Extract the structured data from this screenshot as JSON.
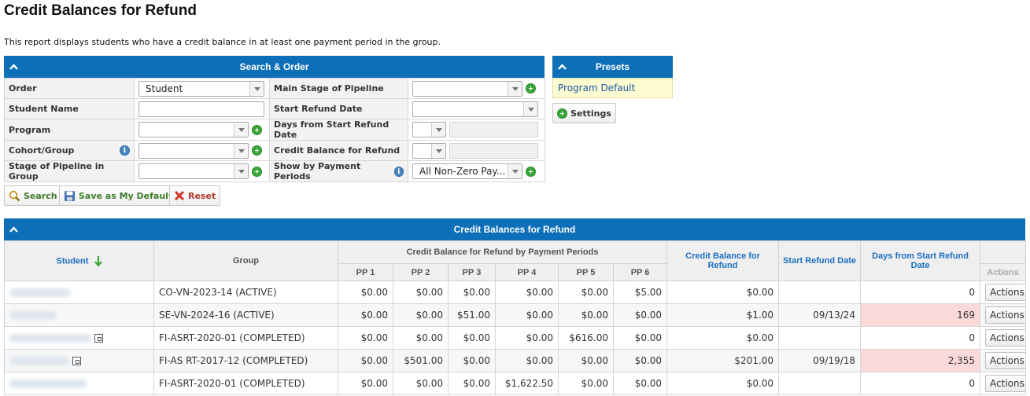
{
  "page": {
    "title": "Credit Balances for Refund",
    "intro": "This report displays students who have a credit balance in at least one payment period in the group."
  },
  "search": {
    "header": "Search & Order",
    "fields": {
      "order": {
        "label": "Order",
        "value": "Student"
      },
      "student_name": {
        "label": "Student Name",
        "value": ""
      },
      "program": {
        "label": "Program",
        "value": ""
      },
      "cohort_group": {
        "label": "Cohort/Group",
        "value": ""
      },
      "stage_in_group": {
        "label": "Stage of Pipeline in Group",
        "value": ""
      },
      "main_stage": {
        "label": "Main Stage of Pipeline",
        "value": ""
      },
      "start_refund_date": {
        "label": "Start Refund Date",
        "value": ""
      },
      "days_from_start": {
        "label": "Days from Start Refund Date",
        "value": ""
      },
      "credit_balance": {
        "label": "Credit Balance for Refund",
        "value": ""
      },
      "show_by_pp": {
        "label": "Show by Payment Periods",
        "value": "All Non-Zero Pay..."
      }
    },
    "buttons": {
      "search": "Search",
      "save_default": "Save as My Default",
      "reset": "Reset"
    }
  },
  "presets": {
    "header": "Presets",
    "items": [
      "Program Default"
    ],
    "settings_label": "Settings"
  },
  "results": {
    "header": "Credit Balances for Refund",
    "columns": {
      "student": "Student",
      "group": "Group",
      "pp_group": "Credit Balance for Refund by Payment Periods",
      "pp": [
        "PP 1",
        "PP 2",
        "PP 3",
        "PP 4",
        "PP 5",
        "PP 6"
      ],
      "credit_balance": "Credit Balance for Refund",
      "start_refund_date": "Start Refund Date",
      "days_from_start": "Days from Start Refund Date",
      "actions": "Actions"
    },
    "rows": [
      {
        "group": "CO-VN-2023-14 (ACTIVE)",
        "pp": [
          "$0.00",
          "$0.00",
          "$0.00",
          "$0.00",
          "$0.00",
          "$5.00"
        ],
        "credit": "$0.00",
        "start_date": "",
        "days": "0",
        "highlight": false,
        "action": "Actions"
      },
      {
        "group": "SE-VN-2024-16 (ACTIVE)",
        "pp": [
          "$0.00",
          "$0.00",
          "$51.00",
          "$0.00",
          "$0.00",
          "$0.00"
        ],
        "credit": "$1.00",
        "start_date": "09/13/24",
        "days": "169",
        "highlight": true,
        "action": "Actions"
      },
      {
        "group": "FI-ASRT-2020-01 (COMPLETED)",
        "pp": [
          "$0.00",
          "$0.00",
          "$0.00",
          "$0.00",
          "$616.00",
          "$0.00"
        ],
        "credit": "$0.00",
        "start_date": "",
        "days": "0",
        "highlight": false,
        "action": "Actions"
      },
      {
        "group": "FI-AS RT-2017-12 (COMPLETED)",
        "pp": [
          "$0.00",
          "$501.00",
          "$0.00",
          "$0.00",
          "$0.00",
          "$0.00"
        ],
        "credit": "$201.00",
        "start_date": "09/19/18",
        "days": "2,355",
        "highlight": true,
        "action": "Actions"
      },
      {
        "group": "FI-ASRT-2020-01 (COMPLETED)",
        "pp": [
          "$0.00",
          "$0.00",
          "$0.00",
          "$1,622.50",
          "$0.00",
          "$0.00"
        ],
        "credit": "$0.00",
        "start_date": "",
        "days": "0",
        "highlight": false,
        "action": "Actions"
      }
    ]
  },
  "colors": {
    "header_blue": "#0c6fb8",
    "highlight_pink": "#fbd9d9",
    "link_blue": "#1a6fc0",
    "add_green": "#3aa63a"
  }
}
